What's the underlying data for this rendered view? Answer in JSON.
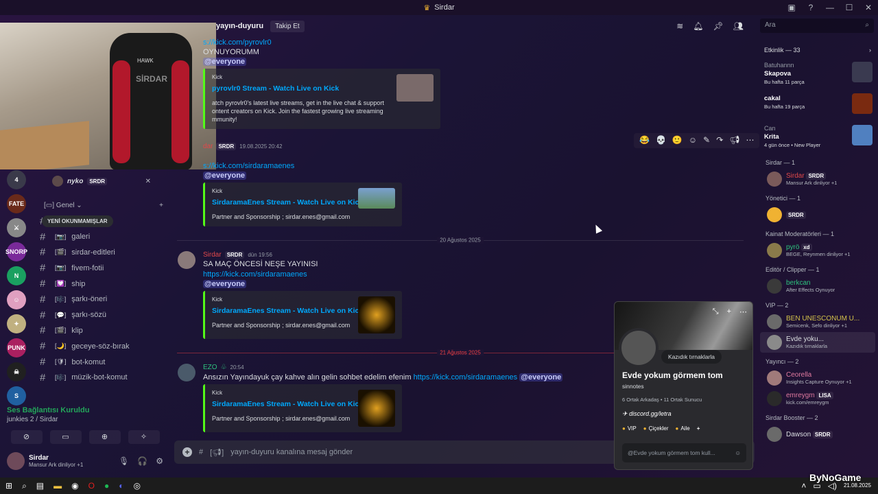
{
  "window": {
    "title": "Sirdar",
    "controls": [
      "—",
      "☐",
      "✕"
    ]
  },
  "webcam": {
    "logo_text": "HAWK",
    "chair_text": "SİRDAR"
  },
  "servers": [
    {
      "label": "4",
      "color": "#3a3a4a"
    },
    {
      "label": "FATE",
      "color": "#6a2a1a"
    },
    {
      "label": "⚔",
      "color": "#888888"
    },
    {
      "label": "SNORP",
      "color": "#7a2a9a"
    },
    {
      "label": "N",
      "color": "#1aa060"
    },
    {
      "label": "☺",
      "color": "#e0a0c0"
    },
    {
      "label": "✦",
      "color": "#c0b080"
    },
    {
      "label": "PUNK",
      "color": "#aa2060"
    },
    {
      "label": "☠",
      "color": "#202020"
    },
    {
      "label": "S",
      "color": "#2060a0"
    }
  ],
  "voice_user": {
    "name": "nyko",
    "role": "SRDR"
  },
  "category": {
    "name": "Genel"
  },
  "channels": [
    {
      "emoji": "💬",
      "name": "sohbet"
    },
    {
      "emoji": "📷",
      "name": "galeri"
    },
    {
      "emoji": "🎬",
      "name": "sirdar-editleri"
    },
    {
      "emoji": "📷",
      "name": "fivem-fotii"
    },
    {
      "emoji": "💟",
      "name": "ship"
    },
    {
      "emoji": "🎼",
      "name": "şarkı-öneri"
    },
    {
      "emoji": "💬",
      "name": "şarkı-sözü"
    },
    {
      "emoji": "🎬",
      "name": "klip"
    },
    {
      "emoji": "🌙",
      "name": "geceye-söz-bırak"
    },
    {
      "emoji": "🛡",
      "name": "bot-komut"
    },
    {
      "emoji": "🎼",
      "name": "müzik-bot-komut"
    }
  ],
  "new_unreads": "YENİ OKUNMAMIŞLAR",
  "voice": {
    "status": "Ses Bağlantısı Kuruldu",
    "channel": "junkies 2 / Sirdar"
  },
  "user": {
    "name": "Sirdar",
    "status": "Mansur Ark dinliyor +1"
  },
  "header": {
    "channel": "yayın-duyuru",
    "follow": "Takip Et"
  },
  "search": {
    "placeholder": "Ara"
  },
  "messages": {
    "m1": {
      "link": "s://kick.com/pyrovlr0",
      "text": "OYNUYORUMM",
      "mention": "@everyone",
      "embed_provider": "Kick",
      "embed_title": "pyrovlr0 Stream - Watch Live on Kick",
      "embed_desc": "atch pyrovlr0's latest live streams, get in the live chat & support ontent creators on Kick. Join the fastest growing live streaming mmunity!"
    },
    "m2": {
      "author": "dar",
      "role": "SRDR",
      "time": "19.08.2025 20:42",
      "link": "s://kick.com/sirdaramaenes",
      "mention": "@everyone",
      "embed_provider": "Kick",
      "embed_title": "SirdaramaEnes Stream - Watch Live on Kick",
      "embed_desc": "Partner and Sponsorship ; sirdar.enes@gmail.com"
    },
    "divider1": "20 Ağustos 2025",
    "m3": {
      "author": "Sirdar",
      "role": "SRDR",
      "time": "dün 19:56",
      "text": "SA MAÇ ÖNCESİ NEŞE YAYINISI",
      "link": "https://kick.com/sirdaramaenes",
      "mention": "@everyone",
      "embed_provider": "Kick",
      "embed_title": "SirdaramaEnes Stream - Watch Live on Kick",
      "embed_desc": "Partner and Sponsorship ; sirdar.enes@gmail.com"
    },
    "divider2": "21 Ağustos 2025",
    "m4": {
      "author": "EZO",
      "time": "20:54",
      "text": "Ansızın Yayındayuk çay kahve alın gelin sohbet edelim efenim",
      "link": "https://kick.com/sirdaramaenes",
      "mention": "@everyone",
      "embed_provider": "Kick",
      "embed_title": "SirdaramaEnes Stream - Watch Live on Kick",
      "embed_desc": "Partner and Sponsorship ; sirdar.enes@gmail.com"
    }
  },
  "composer": {
    "placeholder": "yayın-duyuru kanalına mesaj gönder"
  },
  "activity": {
    "title": "Etkinlik — 33",
    "items": [
      {
        "who": "Batuhannn",
        "game": "Skapova",
        "sub": "Bu hafta 11 parça",
        "color": "#3a3a50"
      },
      {
        "who": "",
        "game": "cakal",
        "sub": "Bu hafta 19 parça",
        "color": "#7a2a10"
      },
      {
        "who": "Can",
        "game": "Krita",
        "sub": "4 gün önce  •  New Player",
        "color": "#5080c0"
      }
    ]
  },
  "member_groups": [
    {
      "title": "Sirdar — 1",
      "members": [
        {
          "name": "Sirdar",
          "badge": "SRDR",
          "status": "Mansur Ark dinliyor +1",
          "color": "#e2484a",
          "av": "#7a5a5a"
        }
      ]
    },
    {
      "title": "Yönetici — 1",
      "members": [
        {
          "name": "",
          "badge": "SRDR",
          "status": "",
          "color": "#e0a020",
          "av": "#f0b232"
        }
      ]
    },
    {
      "title": "Kainat Moderatörleri — 1",
      "members": [
        {
          "name": "pyrö",
          "badge": "xd",
          "status": "BEGE, Reynmen dinliyor +1",
          "color": "#2ec27e",
          "av": "#8a7a4a"
        }
      ]
    },
    {
      "title": "Editör / Clipper — 1",
      "members": [
        {
          "name": "berkcan",
          "badge": "",
          "status": "After Effects Oynuyor",
          "color": "#2ec27e",
          "av": "#3a3a3a"
        }
      ]
    },
    {
      "title": "VIP — 2",
      "members": [
        {
          "name": "BEN UNESCONUM U...",
          "badge": "",
          "status": "Semicenk, Sefo dinliyor +1",
          "color": "#d4c24a",
          "av": "#6a6a6a"
        },
        {
          "name": "Evde yoku...",
          "badge": "",
          "status": "Kazıdık tırnaklarla",
          "color": "#dbdee1",
          "av": "#8a8a8a",
          "selected": true
        }
      ]
    },
    {
      "title": "Yayıncı — 2",
      "members": [
        {
          "name": "Ceorella",
          "badge": "",
          "status": "Insights Capture Oynuyor +1",
          "color": "#e07aa0",
          "av": "#a07a7a"
        },
        {
          "name": "emreygm",
          "badge": "LISA",
          "status": "kick.com/emreygm",
          "color": "#e07aa0",
          "av": "#2a2a2a"
        }
      ]
    },
    {
      "title": "Sirdar Booster — 2",
      "members": [
        {
          "name": "Dawson",
          "badge": "SRDR",
          "status": "",
          "color": "#dbdee1",
          "av": "#6a6a6a"
        }
      ]
    }
  ],
  "profile": {
    "status_bubble": "Kazıdık tırnaklarla",
    "display_name": "Evde yokum görmem tom",
    "username": "sinnotes",
    "mutuals": "6 Ortak Arkadaş  •  11 Ortak Sunucu",
    "link": "discord.gg/letra",
    "roles": [
      "VIP",
      "Çiçekler",
      "Aile"
    ],
    "message_placeholder": "@Evde yokum görmem tom kull..."
  },
  "taskbar": {
    "date": "21.08.2025"
  },
  "watermark": "ByNoGame"
}
